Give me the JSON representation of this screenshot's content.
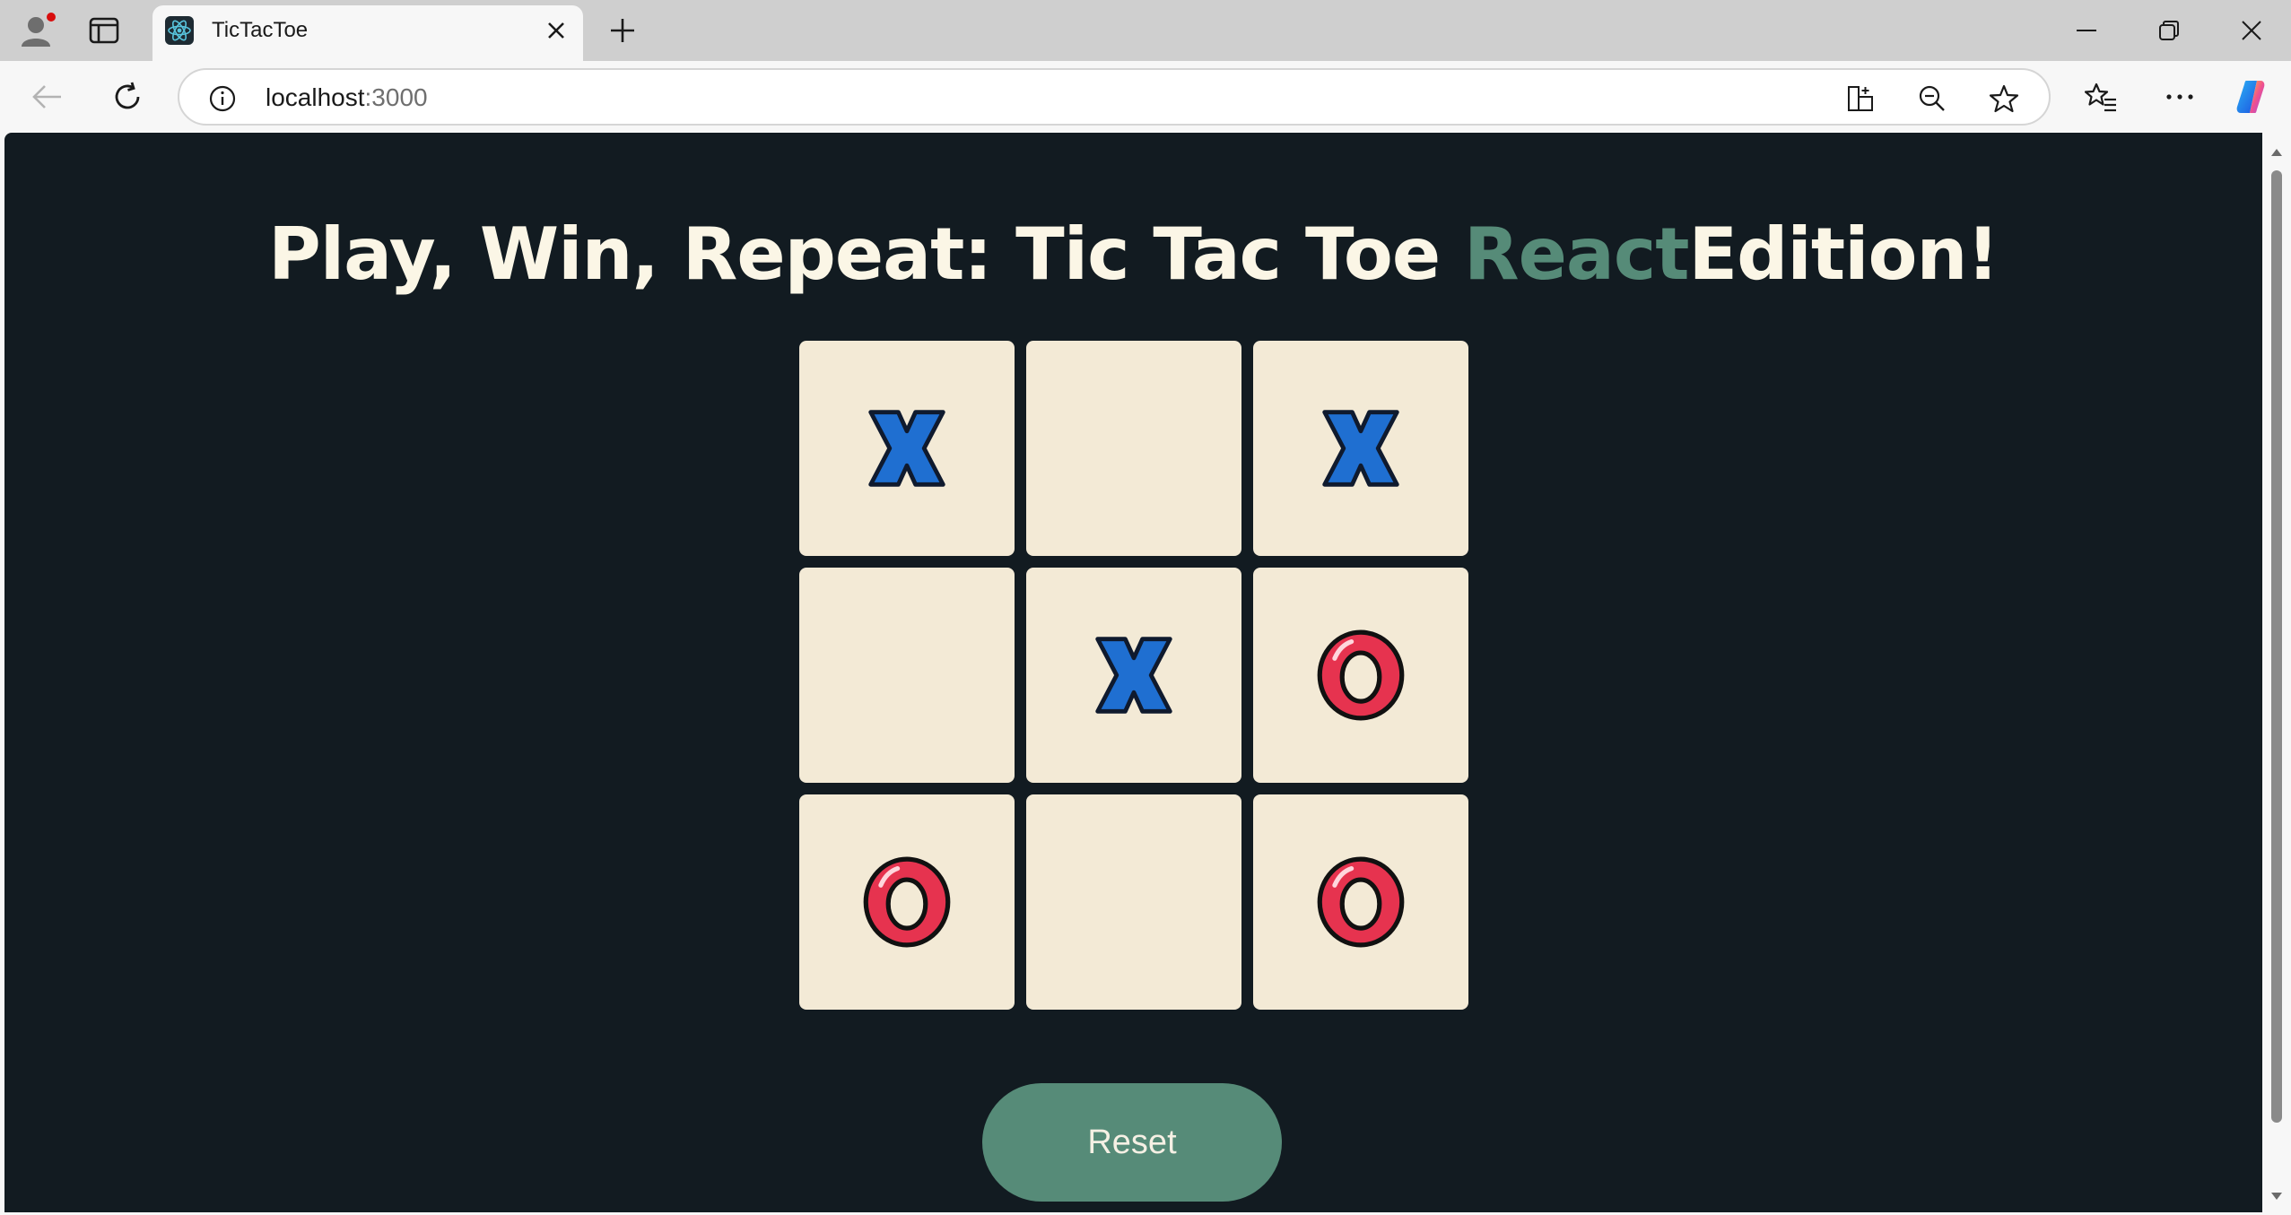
{
  "browser": {
    "tab": {
      "title": "TicTacToe"
    },
    "address": {
      "host": "localhost",
      "port": ":3000"
    },
    "icons": {
      "profile": "profile-avatar-icon",
      "tab_actions": "tab-actions-icon",
      "favicon": "react-logo-icon",
      "tab_close": "close-icon",
      "new_tab": "plus-icon",
      "minimize": "minimize-icon",
      "restore": "restore-icon",
      "close_window": "close-icon",
      "back": "arrow-left-icon",
      "refresh": "refresh-icon",
      "site_info": "info-icon",
      "app_available": "app-available-icon",
      "zoom": "zoom-out-icon",
      "favorite": "star-icon",
      "favorites": "favorites-list-icon",
      "more": "more-icon",
      "copilot": "copilot-icon"
    },
    "colors": {
      "notification_dot": "#d80d0d"
    }
  },
  "page": {
    "title_prefix": "Play, Win, Repeat: Tic Tac Toe ",
    "title_accent": "React",
    "title_suffix": "Edition!",
    "board": [
      [
        "X",
        "",
        "X"
      ],
      [
        "",
        "X",
        "O"
      ],
      [
        "O",
        "",
        "O"
      ]
    ],
    "reset_label": "Reset",
    "colors": {
      "background": "#121b21",
      "accent": "#568b78",
      "cell": "#f3ead6",
      "x_mark": "#1f6fd1",
      "o_mark": "#e6334f",
      "title": "#fbf6e6"
    }
  }
}
